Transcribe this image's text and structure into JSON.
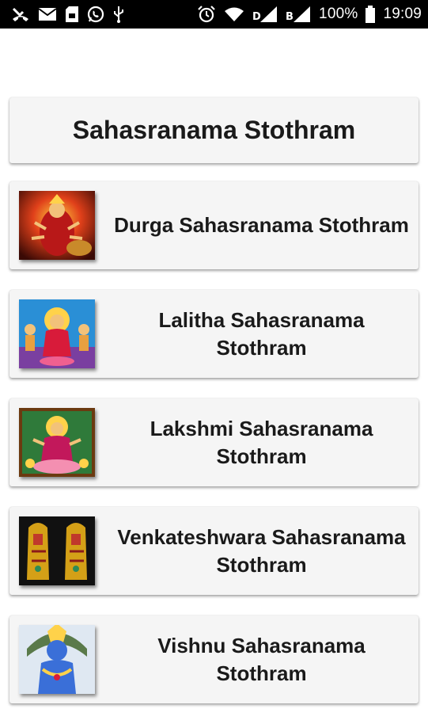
{
  "status_bar": {
    "battery": "100%",
    "time": "19:09",
    "left_icons": [
      "missed-call-icon",
      "mail-icon",
      "sd-card-icon",
      "whatsapp-icon",
      "usb-icon"
    ],
    "right_icons": [
      "alarm-icon",
      "wifi-icon",
      "signal-icon",
      "signal-icon-2",
      "battery-icon"
    ]
  },
  "header": {
    "title": "Sahasranama Stothram"
  },
  "items": [
    {
      "label": "Durga Sahasranama Stothram",
      "image": "durga-image",
      "accent": "#e0401a"
    },
    {
      "label": "Lalitha Sahasranama Stothram",
      "image": "lalitha-image",
      "accent": "#2a8fd6"
    },
    {
      "label": "Lakshmi Sahasranama Stothram",
      "image": "lakshmi-image",
      "accent": "#c2185b"
    },
    {
      "label": "Venkateshwara Sahasranama Stothram",
      "image": "venkateshwara-image",
      "accent": "#d4a017"
    },
    {
      "label": "Vishnu Sahasranama Stothram",
      "image": "vishnu-image",
      "accent": "#3a6fd8"
    }
  ],
  "colors": {
    "card_bg": "#f5f5f5",
    "text": "#1a1a1a",
    "status_bar_bg": "#000000"
  }
}
